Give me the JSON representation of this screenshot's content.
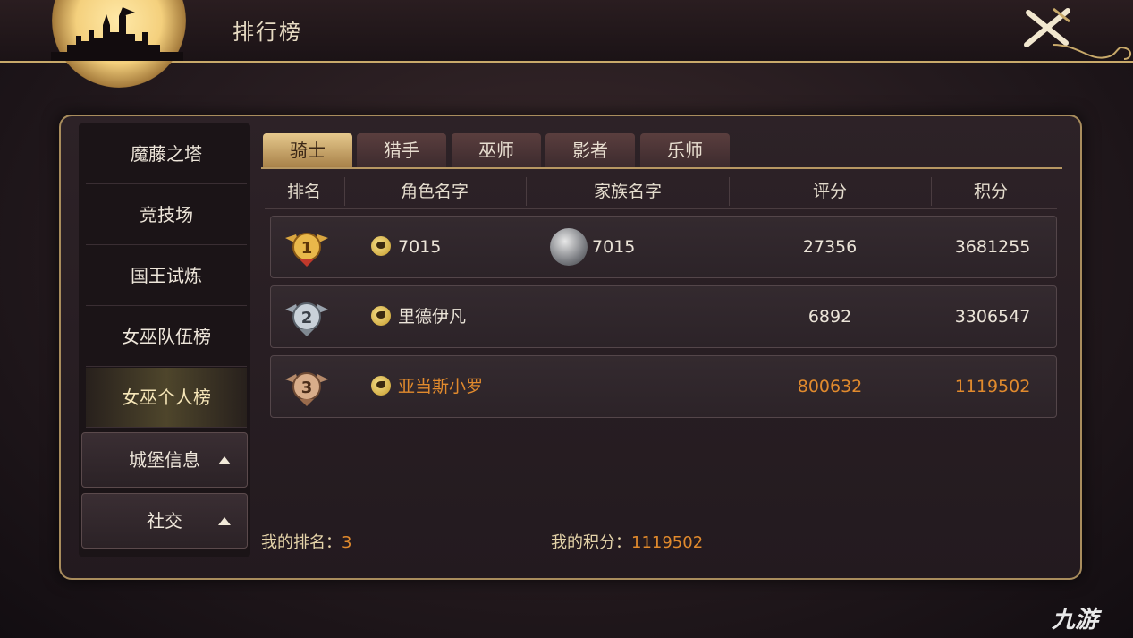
{
  "header": {
    "title": "排行榜"
  },
  "sidebar": {
    "items": [
      {
        "label": "魔藤之塔",
        "active": false
      },
      {
        "label": "竞技场",
        "active": false
      },
      {
        "label": "国王试炼",
        "active": false
      },
      {
        "label": "女巫队伍榜",
        "active": false
      },
      {
        "label": "女巫个人榜",
        "active": true
      }
    ],
    "buttons": [
      {
        "label": "城堡信息"
      },
      {
        "label": "社交"
      }
    ]
  },
  "tabs": [
    {
      "label": "骑士",
      "active": true
    },
    {
      "label": "猎手",
      "active": false
    },
    {
      "label": "巫师",
      "active": false
    },
    {
      "label": "影者",
      "active": false
    },
    {
      "label": "乐师",
      "active": false
    }
  ],
  "table": {
    "columns": [
      "排名",
      "角色名字",
      "家族名字",
      "评分",
      "积分"
    ],
    "rows": [
      {
        "rank": "1",
        "name": "7015",
        "family": "7015",
        "score": "27356",
        "points": "3681255"
      },
      {
        "rank": "2",
        "name": "里德伊凡",
        "family": "",
        "score": "6892",
        "points": "3306547"
      },
      {
        "rank": "3",
        "name": "亚当斯小罗",
        "family": "",
        "score": "800632",
        "points": "1119502"
      }
    ]
  },
  "footer": {
    "my_rank_label": "我的排名：",
    "my_rank_value": "3",
    "my_points_label": "我的积分：",
    "my_points_value": "1119502"
  },
  "watermark": "九游",
  "colors": {
    "accent_gold": "#c8a96a",
    "highlight_orange": "#e18a2d"
  }
}
